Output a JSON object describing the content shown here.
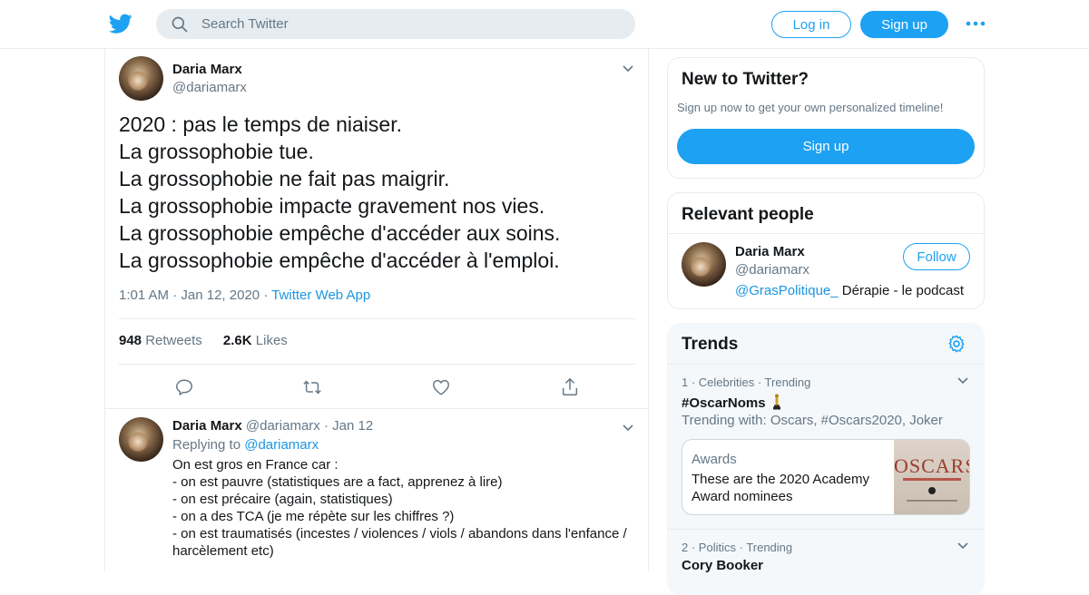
{
  "header": {
    "search_placeholder": "Search Twitter",
    "login_label": "Log in",
    "signup_label": "Sign up",
    "accent_color": "#1da1f2"
  },
  "tweet": {
    "author_name": "Daria Marx",
    "author_handle": "@dariamarx",
    "lines": [
      "2020 : pas le temps de niaiser.",
      "La grossophobie tue.",
      "La grossophobie ne fait pas maigrir.",
      "La grossophobie impacte gravement nos vies.",
      "La grossophobie empêche d'accéder aux soins.",
      "La grossophobie empêche d'accéder à l'emploi."
    ],
    "time": "1:01 AM",
    "date": "Jan 12, 2020",
    "source": "Twitter Web App",
    "retweets_count": "948",
    "retweets_label": "Retweets",
    "likes_count": "2.6K",
    "likes_label": "Likes",
    "action_icons": [
      "reply-icon",
      "retweet-icon",
      "like-icon",
      "share-icon"
    ]
  },
  "reply": {
    "author_name": "Daria Marx",
    "author_handle": "@dariamarx",
    "date": "Jan 12",
    "replying_label": "Replying to",
    "replying_to": "@dariamarx",
    "lines": [
      "On est gros en France car :",
      "- on est pauvre (statistiques are a fact, apprenez à lire)",
      "- on est précaire (again, statistiques)",
      "- on a des TCA (je me répète sur les chiffres ?)",
      "- on est traumatisés (incestes / violences / viols / abandons dans l'enfance / harcèlement etc)"
    ]
  },
  "sidebar": {
    "new_card": {
      "title": "New to Twitter?",
      "subtitle": "Sign up now to get your own personalized timeline!",
      "button": "Sign up"
    },
    "relevant": {
      "title": "Relevant people",
      "name": "Daria Marx",
      "handle": "@dariamarx",
      "bio_link": "@GrasPolitique_",
      "bio_text": "Dérapie - le podcast",
      "follow_label": "Follow"
    },
    "trends": {
      "title": "Trends",
      "items": [
        {
          "rank": "1",
          "category": "Celebrities",
          "status": "Trending",
          "name": "#OscarNoms",
          "trending_with": "Trending with: Oscars, #Oscars2020, Joker",
          "news_category": "Awards",
          "news_headline": "These are the 2020 Academy Award nominees",
          "news_thumb_text": "OSCARS"
        },
        {
          "rank": "2",
          "category": "Politics",
          "status": "Trending",
          "name": "Cory Booker"
        }
      ]
    }
  }
}
